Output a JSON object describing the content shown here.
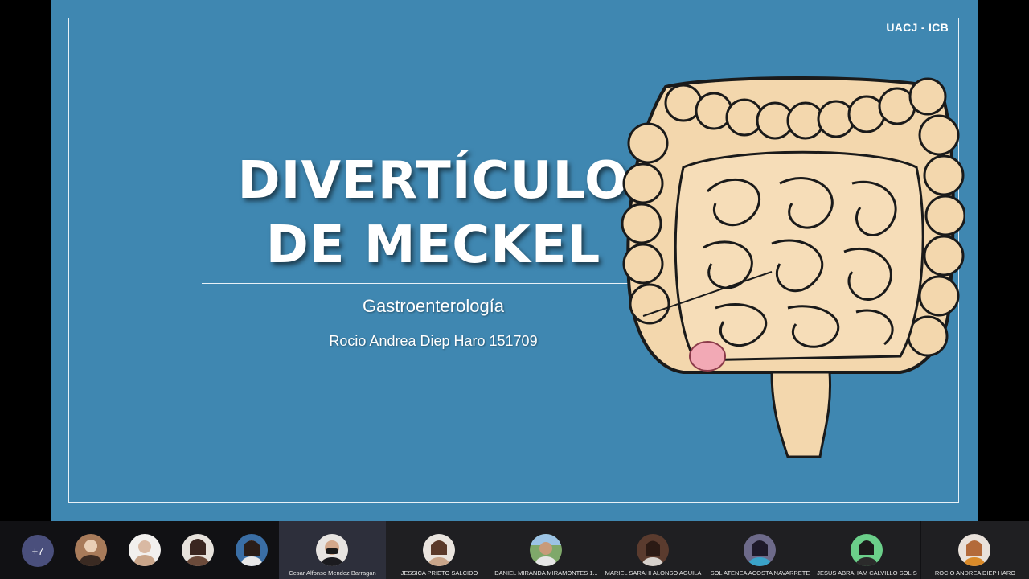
{
  "slide": {
    "org_label": "UACJ - ICB",
    "title_line1": "DIVERTÍCULO",
    "title_line2": "DE MECKEL",
    "subtitle": "Gastroenterología",
    "author": "Rocio Andrea Diep Haro 151709",
    "illustration": "intestine-diagram",
    "colors": {
      "background": "#3f87b1",
      "text": "#ffffff"
    }
  },
  "participants": {
    "more_count": "+7",
    "avatars": [
      {
        "icon": "participant-avatar",
        "color": "#a87b5a"
      },
      {
        "icon": "participant-avatar",
        "color": "#d9c2b0"
      },
      {
        "icon": "participant-avatar",
        "color": "#6b4a3a"
      },
      {
        "icon": "participant-avatar",
        "color": "#3a6ea5"
      }
    ],
    "tiles": [
      {
        "name": "Cesar Alfonso Mendez Barragan",
        "active": true
      },
      {
        "name": "JESSICA PRIETO SALCIDO"
      },
      {
        "name": "DANIEL  MIRANDA  MIRAMONTES 1..."
      },
      {
        "name": "MARIEL SARAHI ALONSO AGUILA"
      },
      {
        "name": "SOL ATENEA ACOSTA NAVARRETE"
      },
      {
        "name": "JESUS ABRAHAM CALVILLO SOLIS"
      },
      {
        "name": "ROCIO ANDREA DIEP HARO"
      }
    ]
  }
}
